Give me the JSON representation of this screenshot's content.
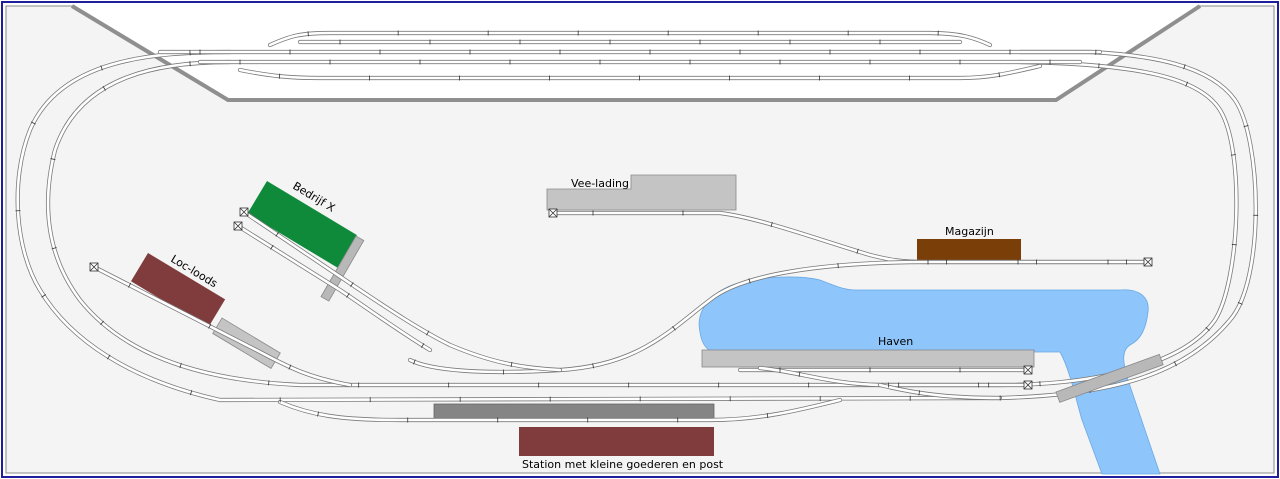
{
  "labels": {
    "vee_lading": "Vee-lading",
    "magazijn": "Magazijn",
    "bedrijf_x": "Bedrijf X",
    "loc_loods": "Loc-loods",
    "haven": "Haven",
    "station": "Station met kleine goederen en post"
  },
  "colors": {
    "frame": "#1f1f9e",
    "baseboard": "#f4f4f4",
    "track": "#7a7a7a",
    "water": "#8ec5fb",
    "platform": "#c4c4c4",
    "platform_dark": "#858585",
    "bedrijf": "#0f8a3a",
    "brick": "#803c3c",
    "magazijn": "#7a3f08",
    "bridge": "#b8b8b8"
  }
}
